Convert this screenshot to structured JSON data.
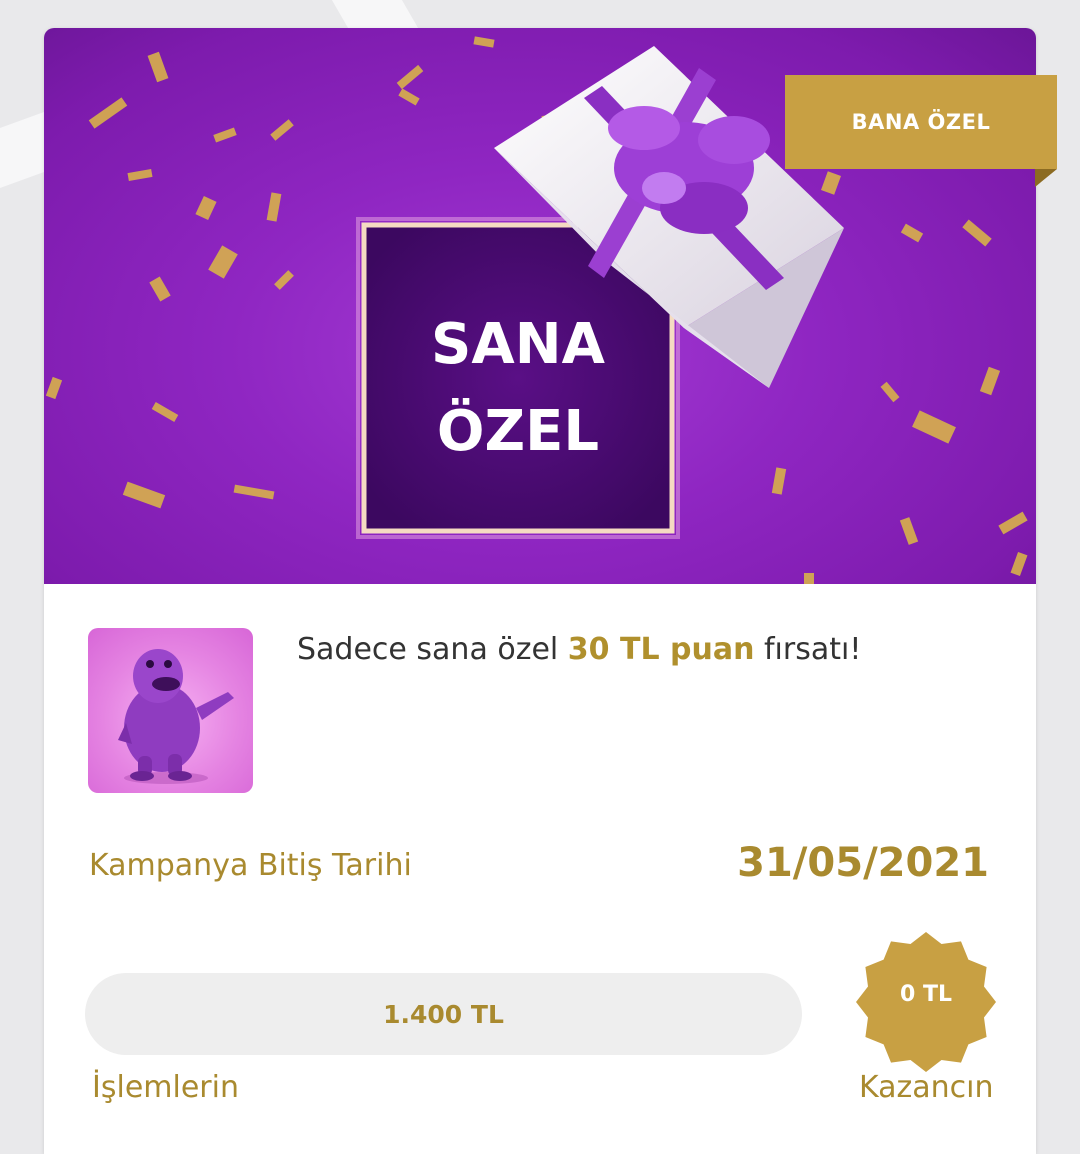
{
  "banner": {
    "headline_line1": "SANA",
    "headline_line2": "ÖZEL",
    "background_color": "#8f26c2",
    "confetti_color": "#d8b24a"
  },
  "badge": {
    "label": "BANA ÖZEL",
    "color": "#c8a043"
  },
  "offer": {
    "thumbnail_icon": "purple-mascot-icon",
    "text_before": "Sadece sana özel ",
    "highlight": "30 TL puan",
    "text_after": " fırsatı!"
  },
  "campaign": {
    "end_label": "Kampanya Bitiş Tarihi",
    "end_date": "31/05/2021"
  },
  "progress": {
    "value_text": "1.400 TL",
    "label": "İşlemlerin",
    "fill_fraction": 0
  },
  "earnings": {
    "value_text": "0 TL",
    "label": "Kazancın",
    "badge_icon": "starburst-seal-icon"
  },
  "colors": {
    "accent_gold": "#c8a043",
    "text_gold": "#a98a2f",
    "text_dark": "#333333"
  }
}
